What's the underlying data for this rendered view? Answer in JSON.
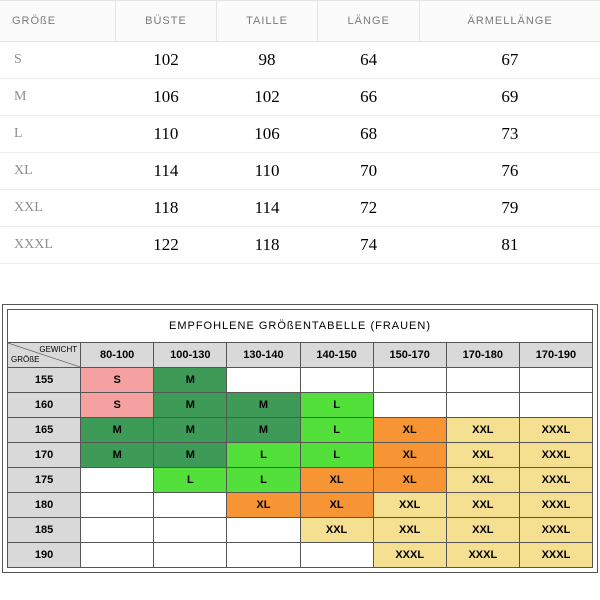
{
  "sizes_table": {
    "headers": [
      "GRÖßE",
      "BÜSTE",
      "TAILLE",
      "LÄNGE",
      "ÄRMELLÄNGE"
    ],
    "rows": [
      {
        "size": "S",
        "bust": "102",
        "waist": "98",
        "length": "64",
        "sleeve": "67"
      },
      {
        "size": "M",
        "bust": "106",
        "waist": "102",
        "length": "66",
        "sleeve": "69"
      },
      {
        "size": "L",
        "bust": "110",
        "waist": "106",
        "length": "68",
        "sleeve": "73"
      },
      {
        "size": "XL",
        "bust": "114",
        "waist": "110",
        "length": "70",
        "sleeve": "76"
      },
      {
        "size": "XXL",
        "bust": "118",
        "waist": "114",
        "length": "72",
        "sleeve": "79"
      },
      {
        "size": "XXXL",
        "bust": "122",
        "waist": "118",
        "length": "74",
        "sleeve": "81"
      }
    ]
  },
  "rec_table": {
    "title": "EMPFOHLENE GRÖßENTABELLE (FRAUEN)",
    "corner_top": "GEWICHT",
    "corner_bottom": "GRÖßE",
    "weights": [
      "80-100",
      "100-130",
      "130-140",
      "140-150",
      "150-170",
      "170-180",
      "170-190"
    ],
    "heights": [
      "155",
      "160",
      "165",
      "170",
      "175",
      "180",
      "185",
      "190"
    ],
    "cells": [
      [
        {
          "v": "S",
          "c": "pink"
        },
        {
          "v": "M",
          "c": "dgreen"
        },
        {
          "v": "",
          "c": ""
        },
        {
          "v": "",
          "c": ""
        },
        {
          "v": "",
          "c": ""
        },
        {
          "v": "",
          "c": ""
        },
        {
          "v": "",
          "c": ""
        }
      ],
      [
        {
          "v": "S",
          "c": "pink"
        },
        {
          "v": "M",
          "c": "dgreen"
        },
        {
          "v": "M",
          "c": "dgreen"
        },
        {
          "v": "L",
          "c": "lgreen"
        },
        {
          "v": "",
          "c": ""
        },
        {
          "v": "",
          "c": ""
        },
        {
          "v": "",
          "c": ""
        }
      ],
      [
        {
          "v": "M",
          "c": "dgreen"
        },
        {
          "v": "M",
          "c": "dgreen"
        },
        {
          "v": "M",
          "c": "dgreen"
        },
        {
          "v": "L",
          "c": "lgreen"
        },
        {
          "v": "XL",
          "c": "orange"
        },
        {
          "v": "XXL",
          "c": "yellow"
        },
        {
          "v": "XXXL",
          "c": "yellow"
        }
      ],
      [
        {
          "v": "M",
          "c": "dgreen"
        },
        {
          "v": "M",
          "c": "dgreen"
        },
        {
          "v": "L",
          "c": "lgreen"
        },
        {
          "v": "L",
          "c": "lgreen"
        },
        {
          "v": "XL",
          "c": "orange"
        },
        {
          "v": "XXL",
          "c": "yellow"
        },
        {
          "v": "XXXL",
          "c": "yellow"
        }
      ],
      [
        {
          "v": "",
          "c": ""
        },
        {
          "v": "L",
          "c": "lgreen"
        },
        {
          "v": "L",
          "c": "lgreen"
        },
        {
          "v": "XL",
          "c": "orange"
        },
        {
          "v": "XL",
          "c": "orange"
        },
        {
          "v": "XXL",
          "c": "yellow"
        },
        {
          "v": "XXXL",
          "c": "yellow"
        }
      ],
      [
        {
          "v": "",
          "c": ""
        },
        {
          "v": "",
          "c": ""
        },
        {
          "v": "XL",
          "c": "orange"
        },
        {
          "v": "XL",
          "c": "orange"
        },
        {
          "v": "XXL",
          "c": "yellow"
        },
        {
          "v": "XXL",
          "c": "yellow"
        },
        {
          "v": "XXXL",
          "c": "yellow"
        }
      ],
      [
        {
          "v": "",
          "c": ""
        },
        {
          "v": "",
          "c": ""
        },
        {
          "v": "",
          "c": ""
        },
        {
          "v": "XXL",
          "c": "yellow"
        },
        {
          "v": "XXL",
          "c": "yellow"
        },
        {
          "v": "XXL",
          "c": "yellow"
        },
        {
          "v": "XXXL",
          "c": "yellow"
        }
      ],
      [
        {
          "v": "",
          "c": ""
        },
        {
          "v": "",
          "c": ""
        },
        {
          "v": "",
          "c": ""
        },
        {
          "v": "",
          "c": ""
        },
        {
          "v": "XXXL",
          "c": "yellow"
        },
        {
          "v": "XXXL",
          "c": "yellow"
        },
        {
          "v": "XXXL",
          "c": "yellow"
        }
      ]
    ]
  }
}
